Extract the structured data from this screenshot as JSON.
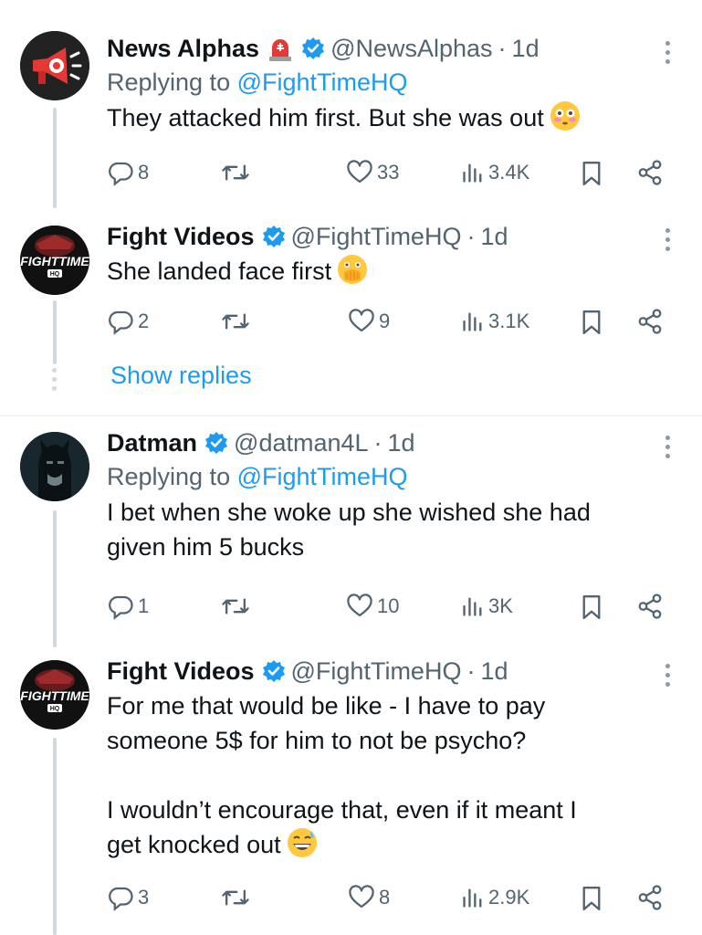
{
  "tweets": [
    {
      "name": "News Alphas",
      "handle": "@NewsAlphas",
      "time": "1d",
      "replying_prefix": "Replying to",
      "replying_to": "@FightTimeHQ",
      "text": "They attacked him first. But she was out",
      "emoji": "flushed-face",
      "name_emoji": "rotating-light",
      "stats": {
        "replies": "8",
        "retweets": "",
        "likes": "33",
        "views": "3.4K"
      }
    },
    {
      "name": "Fight Videos",
      "handle": "@FightTimeHQ",
      "time": "1d",
      "text": "She landed face first",
      "emoji": "face-with-hand-over-mouth",
      "avatar_text": "FIGHTTIME",
      "avatar_sub": "HQ",
      "stats": {
        "replies": "2",
        "retweets": "",
        "likes": "9",
        "views": "3.1K"
      }
    },
    {
      "name": "Datman",
      "handle": "@datman4L",
      "time": "1d",
      "replying_prefix": "Replying to",
      "replying_to": "@FightTimeHQ",
      "text": "I bet when she woke up she wished she had\ngiven him 5 bucks",
      "stats": {
        "replies": "1",
        "retweets": "",
        "likes": "10",
        "views": "3K"
      }
    },
    {
      "name": "Fight Videos",
      "handle": "@FightTimeHQ",
      "time": "1d",
      "text": "For me that would be like - I have to pay\nsomeone 5$ for him to not be psycho?\n\nI wouldn’t encourage that, even if it meant I\nget knocked out",
      "emoji": "grinning-face-with-sweat",
      "avatar_text": "FIGHTTIME",
      "avatar_sub": "HQ",
      "stats": {
        "replies": "3",
        "retweets": "",
        "likes": "8",
        "views": "2.9K"
      }
    }
  ],
  "show_replies": "Show replies",
  "colors": {
    "link": "#1d9bf0",
    "secondary": "#536471",
    "verified": "#1d9bf0",
    "divider": "#e6ecf0"
  }
}
